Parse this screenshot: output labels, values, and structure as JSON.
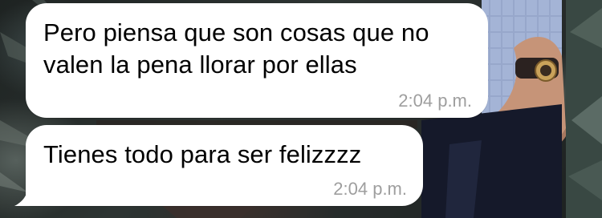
{
  "chat": {
    "messages": [
      {
        "direction": "incoming",
        "text": "Pero piensa que son cosas que no\nvalen la pena llorar por ellas",
        "time": "2:04 p.m."
      },
      {
        "direction": "incoming",
        "text": "Tienes todo para ser felizzzz",
        "time": "2:04 p.m."
      }
    ]
  },
  "colors": {
    "bubble_background": "#ffffff",
    "message_text": "#000000",
    "timestamp_text": "#9e9e9e"
  }
}
